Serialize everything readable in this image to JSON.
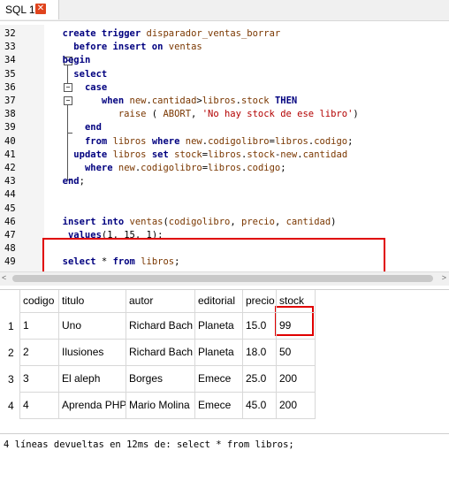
{
  "tab": {
    "label": "SQL 1",
    "close_glyph": "✕"
  },
  "editor": {
    "lines": [
      {
        "num": "32",
        "tokens": [
          [
            "  ",
            ""
          ],
          [
            "create trigger",
            "kw"
          ],
          [
            " ",
            ""
          ],
          [
            "disparador_ventas_borrar",
            "id"
          ]
        ]
      },
      {
        "num": "33",
        "tokens": [
          [
            "    ",
            ""
          ],
          [
            "before insert on",
            "kw"
          ],
          [
            " ",
            ""
          ],
          [
            "ventas",
            "id"
          ]
        ]
      },
      {
        "num": "34",
        "tokens": [
          [
            "  ",
            ""
          ],
          [
            "begin",
            "kw"
          ]
        ]
      },
      {
        "num": "35",
        "tokens": [
          [
            "    ",
            ""
          ],
          [
            "select",
            "kw"
          ]
        ]
      },
      {
        "num": "36",
        "tokens": [
          [
            "      ",
            ""
          ],
          [
            "case",
            "kw"
          ]
        ]
      },
      {
        "num": "37",
        "tokens": [
          [
            "         ",
            ""
          ],
          [
            "when",
            "kw"
          ],
          [
            " ",
            ""
          ],
          [
            "new",
            "id"
          ],
          [
            ".",
            "op"
          ],
          [
            "cantidad",
            "id"
          ],
          [
            ">",
            "op"
          ],
          [
            "libros",
            "id"
          ],
          [
            ".",
            "op"
          ],
          [
            "stock",
            "id"
          ],
          [
            " ",
            ""
          ],
          [
            "THEN",
            "kw"
          ]
        ]
      },
      {
        "num": "38",
        "tokens": [
          [
            "            ",
            ""
          ],
          [
            "raise",
            "id"
          ],
          [
            " ( ",
            "op"
          ],
          [
            "ABORT",
            "id"
          ],
          [
            ", ",
            "op"
          ],
          [
            "'No hay stock de ese libro'",
            "str"
          ],
          [
            ")",
            "op"
          ]
        ]
      },
      {
        "num": "39",
        "tokens": [
          [
            "      ",
            ""
          ],
          [
            "end",
            "kw"
          ]
        ]
      },
      {
        "num": "40",
        "tokens": [
          [
            "      ",
            ""
          ],
          [
            "from",
            "kw"
          ],
          [
            " ",
            ""
          ],
          [
            "libros",
            "id"
          ],
          [
            " ",
            ""
          ],
          [
            "where",
            "kw"
          ],
          [
            " ",
            ""
          ],
          [
            "new",
            "id"
          ],
          [
            ".",
            "op"
          ],
          [
            "codigolibro",
            "id"
          ],
          [
            "=",
            "op"
          ],
          [
            "libros",
            "id"
          ],
          [
            ".",
            "op"
          ],
          [
            "codigo",
            "id"
          ],
          [
            ";",
            "op"
          ]
        ]
      },
      {
        "num": "41",
        "tokens": [
          [
            "    ",
            ""
          ],
          [
            "update",
            "kw"
          ],
          [
            " ",
            ""
          ],
          [
            "libros",
            "id"
          ],
          [
            " ",
            ""
          ],
          [
            "set",
            "kw"
          ],
          [
            " ",
            ""
          ],
          [
            "stock",
            "id"
          ],
          [
            "=",
            "op"
          ],
          [
            "libros",
            "id"
          ],
          [
            ".",
            "op"
          ],
          [
            "stock",
            "id"
          ],
          [
            "-",
            "op"
          ],
          [
            "new",
            "id"
          ],
          [
            ".",
            "op"
          ],
          [
            "cantidad",
            "id"
          ]
        ]
      },
      {
        "num": "42",
        "tokens": [
          [
            "      ",
            ""
          ],
          [
            "where",
            "kw"
          ],
          [
            " ",
            ""
          ],
          [
            "new",
            "id"
          ],
          [
            ".",
            "op"
          ],
          [
            "codigolibro",
            "id"
          ],
          [
            "=",
            "op"
          ],
          [
            "libros",
            "id"
          ],
          [
            ".",
            "op"
          ],
          [
            "codigo",
            "id"
          ],
          [
            ";",
            "op"
          ]
        ]
      },
      {
        "num": "43",
        "tokens": [
          [
            "  ",
            ""
          ],
          [
            "end",
            "kw"
          ],
          [
            ";",
            "op"
          ]
        ]
      },
      {
        "num": "44",
        "tokens": []
      },
      {
        "num": "45",
        "tokens": []
      },
      {
        "num": "46",
        "tokens": [
          [
            "  ",
            ""
          ],
          [
            "insert into",
            "kw"
          ],
          [
            " ",
            ""
          ],
          [
            "ventas",
            "id"
          ],
          [
            "(",
            "op"
          ],
          [
            "codigolibro",
            "id"
          ],
          [
            ", ",
            "op"
          ],
          [
            "precio",
            "id"
          ],
          [
            ", ",
            "op"
          ],
          [
            "cantidad",
            "id"
          ],
          [
            ")",
            "op"
          ]
        ]
      },
      {
        "num": "47",
        "tokens": [
          [
            "   ",
            ""
          ],
          [
            "values",
            "kw"
          ],
          [
            "(",
            "op"
          ],
          [
            "1",
            "num"
          ],
          [
            ", ",
            "op"
          ],
          [
            "15",
            "num"
          ],
          [
            ", ",
            "op"
          ],
          [
            "1",
            "num"
          ],
          [
            ");",
            "op"
          ]
        ]
      },
      {
        "num": "48",
        "tokens": []
      },
      {
        "num": "49",
        "tokens": [
          [
            "  ",
            ""
          ],
          [
            "select",
            "kw"
          ],
          [
            " * ",
            "op"
          ],
          [
            "from",
            "kw"
          ],
          [
            " ",
            ""
          ],
          [
            "libros",
            "id"
          ],
          [
            ";",
            "op"
          ]
        ]
      }
    ]
  },
  "results": {
    "columns": [
      "codigo",
      "titulo",
      "autor",
      "editorial",
      "precio",
      "stock"
    ],
    "rows": [
      {
        "n": "1",
        "cells": [
          "1",
          "Uno",
          "Richard Bach",
          "Planeta",
          "15.0",
          "99"
        ]
      },
      {
        "n": "2",
        "cells": [
          "2",
          "Ilusiones",
          "Richard Bach",
          "Planeta",
          "18.0",
          "50"
        ]
      },
      {
        "n": "3",
        "cells": [
          "3",
          "El aleph",
          "Borges",
          "Emece",
          "25.0",
          "200"
        ]
      },
      {
        "n": "4",
        "cells": [
          "4",
          "Aprenda PHP",
          "Mario Molina",
          "Emece",
          "45.0",
          "200"
        ]
      }
    ]
  },
  "log": {
    "message": "4 líneas devueltas en 12ms de: select * from libros;"
  },
  "colors": {
    "keyword": "#00007f",
    "identifier": "#7a3700",
    "string": "#b30000",
    "highlight": "#e00000"
  }
}
